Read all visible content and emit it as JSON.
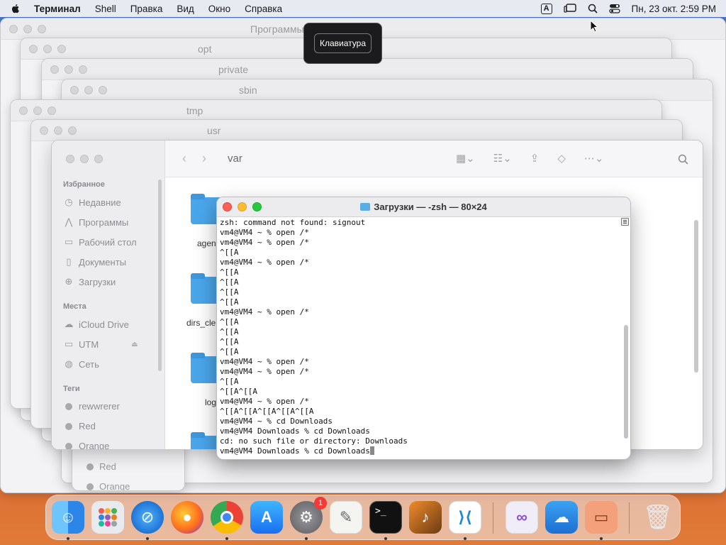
{
  "menubar": {
    "app_name": "Терминал",
    "items": [
      "Shell",
      "Правка",
      "Вид",
      "Окно",
      "Справка"
    ],
    "input_badge": "A",
    "datetime": "Пн, 23 окт. 2:59 PM"
  },
  "tooltip": {
    "text": "Клавиатура"
  },
  "background_windows": {
    "titles": [
      "Программы",
      "opt",
      "private",
      "sbin",
      "tmp",
      "usr"
    ]
  },
  "finder": {
    "title": "var",
    "sidebar": {
      "favorites_header": "Избранное",
      "favorites": [
        "Недавние",
        "Программы",
        "Рабочий стол",
        "Документы",
        "Загрузки"
      ],
      "locations_header": "Места",
      "locations": [
        "iCloud Drive",
        "UTM",
        "Сеть"
      ],
      "tags_header": "Теги",
      "tags": [
        "rewwrerer",
        "Red",
        "Orange"
      ]
    },
    "folders": [
      "agen",
      "dirs_cle",
      "log"
    ],
    "behind_tags": [
      "Red",
      "Orange"
    ]
  },
  "terminal": {
    "title": "Загрузки — -zsh — 80×24",
    "lines": [
      "zsh: command not found: signout",
      "vm4@VM4 ~ % open /*",
      "vm4@VM4 ~ % open /*",
      "^[[A",
      "vm4@VM4 ~ % open /*",
      "^[[A",
      "^[[A",
      "^[[A",
      "^[[A",
      "vm4@VM4 ~ % open /*",
      "^[[A",
      "^[[A",
      "^[[A",
      "^[[A",
      "vm4@VM4 ~ % open /*",
      "vm4@VM4 ~ % open /*",
      "^[[A",
      "^[[A^[[A",
      "vm4@VM4 ~ % open /*",
      "^[[A^[[A^[[A^[[A^[[A",
      "vm4@VM4 ~ % cd Downloads",
      "vm4@VM4 Downloads % cd Downloads",
      "cd: no such file or directory: Downloads",
      "vm4@VM4 Downloads % cd Downloads"
    ]
  },
  "dock": {
    "apps": [
      "finder",
      "launchpad",
      "safari",
      "firefox",
      "chrome",
      "app-store",
      "system-settings",
      "textedit",
      "terminal",
      "garageband",
      "vscode",
      "visual-studio",
      "weather",
      "utm",
      "trash"
    ],
    "settings_badge": "1"
  }
}
